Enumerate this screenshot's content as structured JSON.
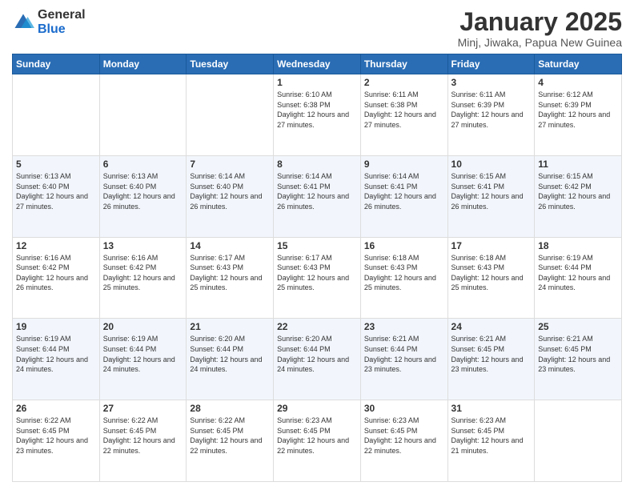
{
  "header": {
    "logo_general": "General",
    "logo_blue": "Blue",
    "title": "January 2025",
    "subtitle": "Minj, Jiwaka, Papua New Guinea"
  },
  "days_of_week": [
    "Sunday",
    "Monday",
    "Tuesday",
    "Wednesday",
    "Thursday",
    "Friday",
    "Saturday"
  ],
  "weeks": [
    [
      {
        "day": "",
        "info": ""
      },
      {
        "day": "",
        "info": ""
      },
      {
        "day": "",
        "info": ""
      },
      {
        "day": "1",
        "info": "Sunrise: 6:10 AM\nSunset: 6:38 PM\nDaylight: 12 hours\nand 27 minutes."
      },
      {
        "day": "2",
        "info": "Sunrise: 6:11 AM\nSunset: 6:38 PM\nDaylight: 12 hours\nand 27 minutes."
      },
      {
        "day": "3",
        "info": "Sunrise: 6:11 AM\nSunset: 6:39 PM\nDaylight: 12 hours\nand 27 minutes."
      },
      {
        "day": "4",
        "info": "Sunrise: 6:12 AM\nSunset: 6:39 PM\nDaylight: 12 hours\nand 27 minutes."
      }
    ],
    [
      {
        "day": "5",
        "info": "Sunrise: 6:13 AM\nSunset: 6:40 PM\nDaylight: 12 hours\nand 27 minutes."
      },
      {
        "day": "6",
        "info": "Sunrise: 6:13 AM\nSunset: 6:40 PM\nDaylight: 12 hours\nand 26 minutes."
      },
      {
        "day": "7",
        "info": "Sunrise: 6:14 AM\nSunset: 6:40 PM\nDaylight: 12 hours\nand 26 minutes."
      },
      {
        "day": "8",
        "info": "Sunrise: 6:14 AM\nSunset: 6:41 PM\nDaylight: 12 hours\nand 26 minutes."
      },
      {
        "day": "9",
        "info": "Sunrise: 6:14 AM\nSunset: 6:41 PM\nDaylight: 12 hours\nand 26 minutes."
      },
      {
        "day": "10",
        "info": "Sunrise: 6:15 AM\nSunset: 6:41 PM\nDaylight: 12 hours\nand 26 minutes."
      },
      {
        "day": "11",
        "info": "Sunrise: 6:15 AM\nSunset: 6:42 PM\nDaylight: 12 hours\nand 26 minutes."
      }
    ],
    [
      {
        "day": "12",
        "info": "Sunrise: 6:16 AM\nSunset: 6:42 PM\nDaylight: 12 hours\nand 26 minutes."
      },
      {
        "day": "13",
        "info": "Sunrise: 6:16 AM\nSunset: 6:42 PM\nDaylight: 12 hours\nand 25 minutes."
      },
      {
        "day": "14",
        "info": "Sunrise: 6:17 AM\nSunset: 6:43 PM\nDaylight: 12 hours\nand 25 minutes."
      },
      {
        "day": "15",
        "info": "Sunrise: 6:17 AM\nSunset: 6:43 PM\nDaylight: 12 hours\nand 25 minutes."
      },
      {
        "day": "16",
        "info": "Sunrise: 6:18 AM\nSunset: 6:43 PM\nDaylight: 12 hours\nand 25 minutes."
      },
      {
        "day": "17",
        "info": "Sunrise: 6:18 AM\nSunset: 6:43 PM\nDaylight: 12 hours\nand 25 minutes."
      },
      {
        "day": "18",
        "info": "Sunrise: 6:19 AM\nSunset: 6:44 PM\nDaylight: 12 hours\nand 24 minutes."
      }
    ],
    [
      {
        "day": "19",
        "info": "Sunrise: 6:19 AM\nSunset: 6:44 PM\nDaylight: 12 hours\nand 24 minutes."
      },
      {
        "day": "20",
        "info": "Sunrise: 6:19 AM\nSunset: 6:44 PM\nDaylight: 12 hours\nand 24 minutes."
      },
      {
        "day": "21",
        "info": "Sunrise: 6:20 AM\nSunset: 6:44 PM\nDaylight: 12 hours\nand 24 minutes."
      },
      {
        "day": "22",
        "info": "Sunrise: 6:20 AM\nSunset: 6:44 PM\nDaylight: 12 hours\nand 24 minutes."
      },
      {
        "day": "23",
        "info": "Sunrise: 6:21 AM\nSunset: 6:44 PM\nDaylight: 12 hours\nand 23 minutes."
      },
      {
        "day": "24",
        "info": "Sunrise: 6:21 AM\nSunset: 6:45 PM\nDaylight: 12 hours\nand 23 minutes."
      },
      {
        "day": "25",
        "info": "Sunrise: 6:21 AM\nSunset: 6:45 PM\nDaylight: 12 hours\nand 23 minutes."
      }
    ],
    [
      {
        "day": "26",
        "info": "Sunrise: 6:22 AM\nSunset: 6:45 PM\nDaylight: 12 hours\nand 23 minutes."
      },
      {
        "day": "27",
        "info": "Sunrise: 6:22 AM\nSunset: 6:45 PM\nDaylight: 12 hours\nand 22 minutes."
      },
      {
        "day": "28",
        "info": "Sunrise: 6:22 AM\nSunset: 6:45 PM\nDaylight: 12 hours\nand 22 minutes."
      },
      {
        "day": "29",
        "info": "Sunrise: 6:23 AM\nSunset: 6:45 PM\nDaylight: 12 hours\nand 22 minutes."
      },
      {
        "day": "30",
        "info": "Sunrise: 6:23 AM\nSunset: 6:45 PM\nDaylight: 12 hours\nand 22 minutes."
      },
      {
        "day": "31",
        "info": "Sunrise: 6:23 AM\nSunset: 6:45 PM\nDaylight: 12 hours\nand 21 minutes."
      },
      {
        "day": "",
        "info": ""
      }
    ]
  ]
}
